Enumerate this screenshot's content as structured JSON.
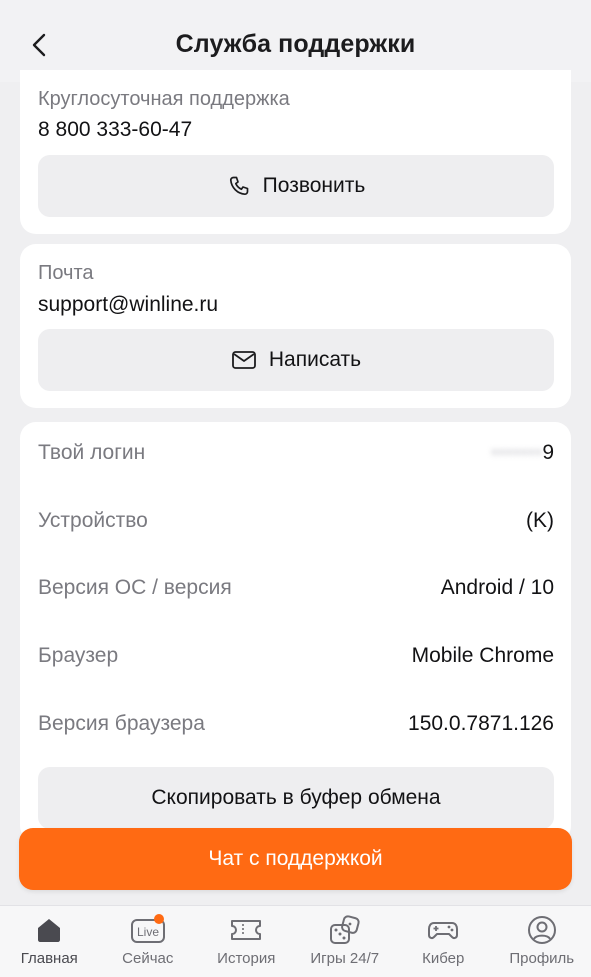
{
  "header": {
    "title": "Служба поддержки"
  },
  "phone_card": {
    "label": "Круглосуточная поддержка",
    "value": "8 800 333-60-47",
    "button": "Позвонить"
  },
  "mail_card": {
    "label": "Почта",
    "value": "support@winline.ru",
    "button": "Написать"
  },
  "info_card": {
    "rows": [
      {
        "key": "Твой логин",
        "value": "9"
      },
      {
        "key": "Устройство",
        "value": "(K)"
      },
      {
        "key": "Версия ОС / версия",
        "value": "Android / 10"
      },
      {
        "key": "Браузер",
        "value": "Mobile Chrome"
      },
      {
        "key": "Версия браузера",
        "value": "150.0.7871.126"
      }
    ],
    "copy_button": "Скопировать в буфер обмена"
  },
  "chat_button": "Чат с поддержкой",
  "tabbar": {
    "items": [
      {
        "label": "Главная",
        "icon": "home-icon"
      },
      {
        "label": "Сейчас",
        "icon": "live-icon",
        "badge_text": "Live"
      },
      {
        "label": "История",
        "icon": "ticket-icon"
      },
      {
        "label": "Игры 24/7",
        "icon": "dice-icon"
      },
      {
        "label": "Кибер",
        "icon": "gamepad-icon"
      },
      {
        "label": "Профиль",
        "icon": "profile-icon"
      }
    ]
  },
  "colors": {
    "accent": "#ff6a13",
    "background": "#efeff1",
    "card": "#ffffff"
  }
}
